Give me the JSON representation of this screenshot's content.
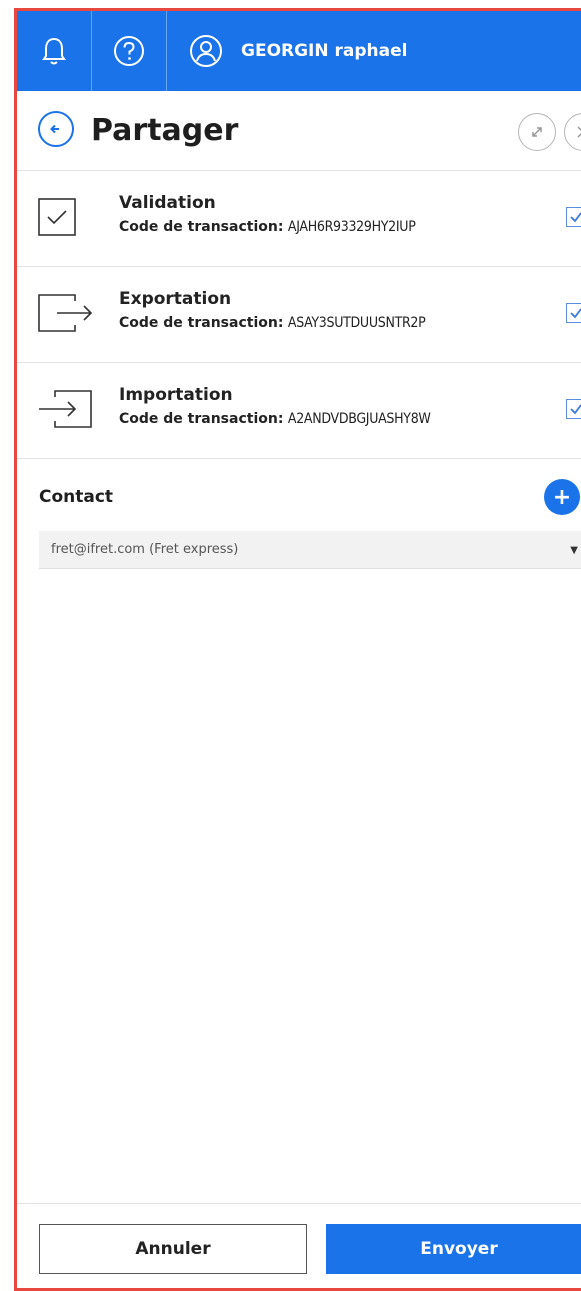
{
  "topbar": {
    "user_name": "GEORGIN raphael",
    "bell_icon": "bell-icon",
    "help_icon": "help-icon",
    "user_icon": "user-icon"
  },
  "header": {
    "title": "Partager",
    "back_icon": "back-arrow-icon",
    "expand_icon": "expand-icon",
    "close_icon": "close-icon"
  },
  "items": [
    {
      "name": "Validation",
      "code_label": "Code de transaction:",
      "code": "AJAH6R93329HY2IUP",
      "icon": "check-square-icon",
      "checked": true
    },
    {
      "name": "Exportation",
      "code_label": "Code de transaction:",
      "code": "ASAY3SUTDUUSNTR2P",
      "icon": "export-icon",
      "checked": true
    },
    {
      "name": "Importation",
      "code_label": "Code de transaction:",
      "code": "A2ANDVDBGJUASHY8W",
      "icon": "import-icon",
      "checked": true
    }
  ],
  "contact": {
    "label": "Contact",
    "add_label": "+",
    "selected": "fret@ifret.com (Fret express)"
  },
  "footer": {
    "cancel_label": "Annuler",
    "send_label": "Envoyer"
  },
  "colors": {
    "primary": "#1a73e8",
    "frame_border": "#e8473f"
  }
}
